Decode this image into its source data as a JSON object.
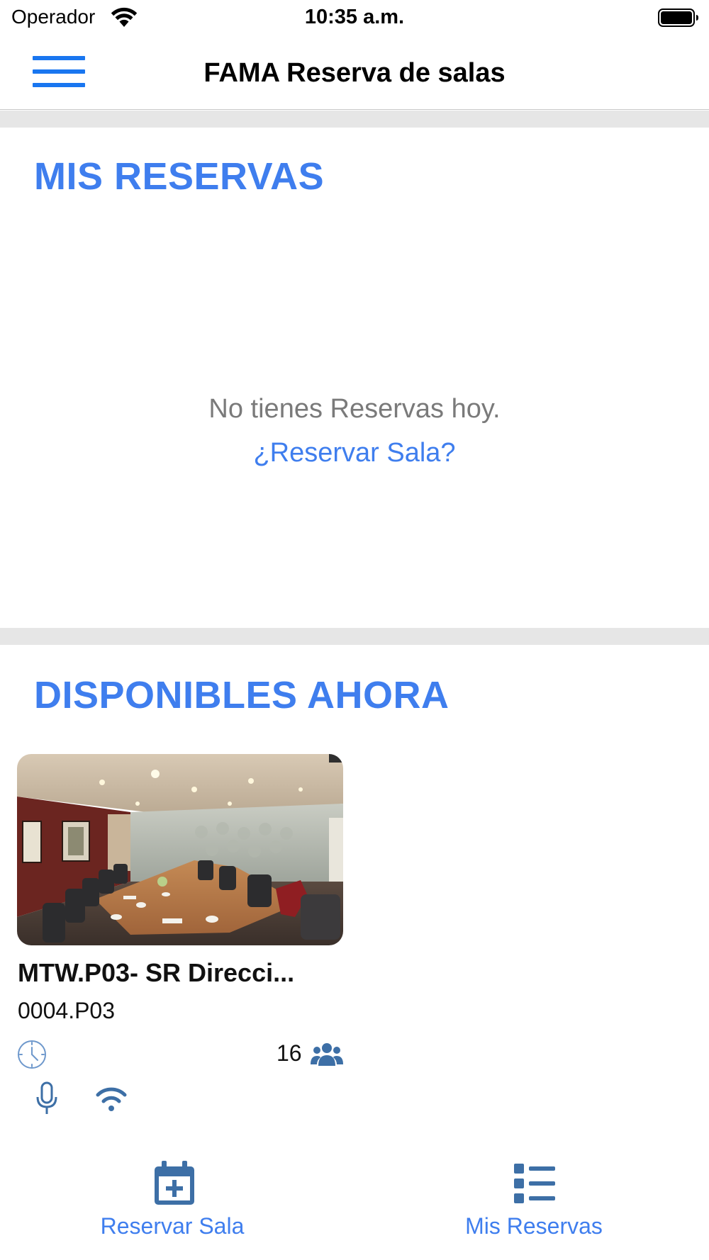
{
  "status_bar": {
    "carrier": "Operador",
    "time": "10:35 a.m."
  },
  "nav": {
    "title": "FAMA Reserva de salas",
    "menu_icon": "hamburger-menu-icon"
  },
  "my_reservations": {
    "title": "MIS RESERVAS",
    "empty_message": "No tienes Reservas hoy.",
    "reserve_link": "¿Reservar Sala?"
  },
  "available": {
    "title": "DISPONIBLES AHORA",
    "rooms": [
      {
        "name": "MTW.P03- SR Direcci...",
        "code": "0004.P03",
        "capacity": "16",
        "amenities": [
          "microphone-icon",
          "wifi-icon"
        ]
      }
    ]
  },
  "tab_bar": {
    "tabs": [
      {
        "label": "Reservar Sala",
        "icon": "calendar-plus-icon"
      },
      {
        "label": "Mis Reservas",
        "icon": "list-icon"
      }
    ]
  },
  "colors": {
    "accent": "#3f7eee",
    "menu_blue": "#1976f0",
    "icon_steel": "#3d6fa6",
    "separator": "#e6e6e6",
    "muted_text": "#7a7a7a"
  }
}
